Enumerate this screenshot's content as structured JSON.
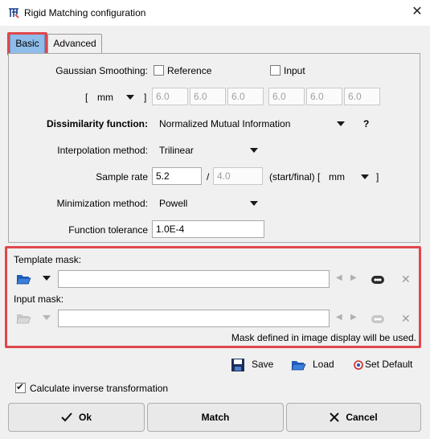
{
  "window": {
    "title": "Rigid Matching configuration",
    "close_glyph": "✕"
  },
  "tabs": [
    {
      "label": "Basic",
      "active": true
    },
    {
      "label": "Advanced",
      "active": false
    }
  ],
  "basic": {
    "gaussian_label": "Gaussian Smoothing:",
    "reference_label": "Reference",
    "reference_checked": false,
    "input_label": "Input",
    "input_checked": false,
    "unit_open": "[",
    "unit_value": "mm",
    "unit_close": "]",
    "reference_fwhm": [
      "6.0",
      "6.0",
      "6.0"
    ],
    "input_fwhm": [
      "6.0",
      "6.0",
      "6.0"
    ],
    "dissimilarity_label": "Dissimilarity function:",
    "dissimilarity_value": "Normalized Mutual Information",
    "help_glyph": "?",
    "interpolation_label": "Interpolation method:",
    "interpolation_value": "Trilinear",
    "sample_rate_label": "Sample rate",
    "sample_rate_start": "5.2",
    "sample_rate_sep": "/",
    "sample_rate_final": "4.0",
    "sample_rate_suffix": "(start/final) [",
    "sample_rate_unit": "mm",
    "sample_rate_close": "]",
    "minimization_label": "Minimization method:",
    "minimization_value": "Powell",
    "tolerance_label": "Function tolerance",
    "tolerance_value": "1.0E-4"
  },
  "masks": {
    "template_label": "Template mask:",
    "template_value": "",
    "input_label": "Input mask:",
    "input_value": "",
    "note": "Mask defined in image display will be used."
  },
  "actions": {
    "save_label": "Save",
    "load_label": "Load",
    "set_default_label": "Set Default"
  },
  "inverse": {
    "label": "Calculate inverse transformation",
    "checked": true
  },
  "buttons": {
    "ok_label": "Ok",
    "match_label": "Match",
    "cancel_label": "Cancel"
  },
  "colors": {
    "highlight": "#e0474c",
    "active_tab": "#8fbcea",
    "folder_blue": "#1f5fbf"
  }
}
